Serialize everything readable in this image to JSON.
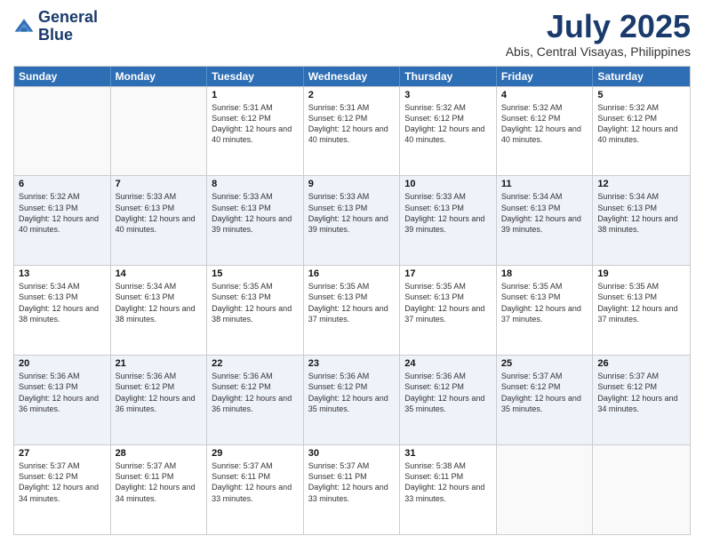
{
  "logo": {
    "line1": "General",
    "line2": "Blue"
  },
  "title": "July 2025",
  "location": "Abis, Central Visayas, Philippines",
  "weekdays": [
    "Sunday",
    "Monday",
    "Tuesday",
    "Wednesday",
    "Thursday",
    "Friday",
    "Saturday"
  ],
  "rows": [
    [
      {
        "day": "",
        "sunrise": "",
        "sunset": "",
        "daylight": ""
      },
      {
        "day": "",
        "sunrise": "",
        "sunset": "",
        "daylight": ""
      },
      {
        "day": "1",
        "sunrise": "Sunrise: 5:31 AM",
        "sunset": "Sunset: 6:12 PM",
        "daylight": "Daylight: 12 hours and 40 minutes."
      },
      {
        "day": "2",
        "sunrise": "Sunrise: 5:31 AM",
        "sunset": "Sunset: 6:12 PM",
        "daylight": "Daylight: 12 hours and 40 minutes."
      },
      {
        "day": "3",
        "sunrise": "Sunrise: 5:32 AM",
        "sunset": "Sunset: 6:12 PM",
        "daylight": "Daylight: 12 hours and 40 minutes."
      },
      {
        "day": "4",
        "sunrise": "Sunrise: 5:32 AM",
        "sunset": "Sunset: 6:12 PM",
        "daylight": "Daylight: 12 hours and 40 minutes."
      },
      {
        "day": "5",
        "sunrise": "Sunrise: 5:32 AM",
        "sunset": "Sunset: 6:12 PM",
        "daylight": "Daylight: 12 hours and 40 minutes."
      }
    ],
    [
      {
        "day": "6",
        "sunrise": "Sunrise: 5:32 AM",
        "sunset": "Sunset: 6:13 PM",
        "daylight": "Daylight: 12 hours and 40 minutes."
      },
      {
        "day": "7",
        "sunrise": "Sunrise: 5:33 AM",
        "sunset": "Sunset: 6:13 PM",
        "daylight": "Daylight: 12 hours and 40 minutes."
      },
      {
        "day": "8",
        "sunrise": "Sunrise: 5:33 AM",
        "sunset": "Sunset: 6:13 PM",
        "daylight": "Daylight: 12 hours and 39 minutes."
      },
      {
        "day": "9",
        "sunrise": "Sunrise: 5:33 AM",
        "sunset": "Sunset: 6:13 PM",
        "daylight": "Daylight: 12 hours and 39 minutes."
      },
      {
        "day": "10",
        "sunrise": "Sunrise: 5:33 AM",
        "sunset": "Sunset: 6:13 PM",
        "daylight": "Daylight: 12 hours and 39 minutes."
      },
      {
        "day": "11",
        "sunrise": "Sunrise: 5:34 AM",
        "sunset": "Sunset: 6:13 PM",
        "daylight": "Daylight: 12 hours and 39 minutes."
      },
      {
        "day": "12",
        "sunrise": "Sunrise: 5:34 AM",
        "sunset": "Sunset: 6:13 PM",
        "daylight": "Daylight: 12 hours and 38 minutes."
      }
    ],
    [
      {
        "day": "13",
        "sunrise": "Sunrise: 5:34 AM",
        "sunset": "Sunset: 6:13 PM",
        "daylight": "Daylight: 12 hours and 38 minutes."
      },
      {
        "day": "14",
        "sunrise": "Sunrise: 5:34 AM",
        "sunset": "Sunset: 6:13 PM",
        "daylight": "Daylight: 12 hours and 38 minutes."
      },
      {
        "day": "15",
        "sunrise": "Sunrise: 5:35 AM",
        "sunset": "Sunset: 6:13 PM",
        "daylight": "Daylight: 12 hours and 38 minutes."
      },
      {
        "day": "16",
        "sunrise": "Sunrise: 5:35 AM",
        "sunset": "Sunset: 6:13 PM",
        "daylight": "Daylight: 12 hours and 37 minutes."
      },
      {
        "day": "17",
        "sunrise": "Sunrise: 5:35 AM",
        "sunset": "Sunset: 6:13 PM",
        "daylight": "Daylight: 12 hours and 37 minutes."
      },
      {
        "day": "18",
        "sunrise": "Sunrise: 5:35 AM",
        "sunset": "Sunset: 6:13 PM",
        "daylight": "Daylight: 12 hours and 37 minutes."
      },
      {
        "day": "19",
        "sunrise": "Sunrise: 5:35 AM",
        "sunset": "Sunset: 6:13 PM",
        "daylight": "Daylight: 12 hours and 37 minutes."
      }
    ],
    [
      {
        "day": "20",
        "sunrise": "Sunrise: 5:36 AM",
        "sunset": "Sunset: 6:13 PM",
        "daylight": "Daylight: 12 hours and 36 minutes."
      },
      {
        "day": "21",
        "sunrise": "Sunrise: 5:36 AM",
        "sunset": "Sunset: 6:12 PM",
        "daylight": "Daylight: 12 hours and 36 minutes."
      },
      {
        "day": "22",
        "sunrise": "Sunrise: 5:36 AM",
        "sunset": "Sunset: 6:12 PM",
        "daylight": "Daylight: 12 hours and 36 minutes."
      },
      {
        "day": "23",
        "sunrise": "Sunrise: 5:36 AM",
        "sunset": "Sunset: 6:12 PM",
        "daylight": "Daylight: 12 hours and 35 minutes."
      },
      {
        "day": "24",
        "sunrise": "Sunrise: 5:36 AM",
        "sunset": "Sunset: 6:12 PM",
        "daylight": "Daylight: 12 hours and 35 minutes."
      },
      {
        "day": "25",
        "sunrise": "Sunrise: 5:37 AM",
        "sunset": "Sunset: 6:12 PM",
        "daylight": "Daylight: 12 hours and 35 minutes."
      },
      {
        "day": "26",
        "sunrise": "Sunrise: 5:37 AM",
        "sunset": "Sunset: 6:12 PM",
        "daylight": "Daylight: 12 hours and 34 minutes."
      }
    ],
    [
      {
        "day": "27",
        "sunrise": "Sunrise: 5:37 AM",
        "sunset": "Sunset: 6:12 PM",
        "daylight": "Daylight: 12 hours and 34 minutes."
      },
      {
        "day": "28",
        "sunrise": "Sunrise: 5:37 AM",
        "sunset": "Sunset: 6:11 PM",
        "daylight": "Daylight: 12 hours and 34 minutes."
      },
      {
        "day": "29",
        "sunrise": "Sunrise: 5:37 AM",
        "sunset": "Sunset: 6:11 PM",
        "daylight": "Daylight: 12 hours and 33 minutes."
      },
      {
        "day": "30",
        "sunrise": "Sunrise: 5:37 AM",
        "sunset": "Sunset: 6:11 PM",
        "daylight": "Daylight: 12 hours and 33 minutes."
      },
      {
        "day": "31",
        "sunrise": "Sunrise: 5:38 AM",
        "sunset": "Sunset: 6:11 PM",
        "daylight": "Daylight: 12 hours and 33 minutes."
      },
      {
        "day": "",
        "sunrise": "",
        "sunset": "",
        "daylight": ""
      },
      {
        "day": "",
        "sunrise": "",
        "sunset": "",
        "daylight": ""
      }
    ]
  ]
}
